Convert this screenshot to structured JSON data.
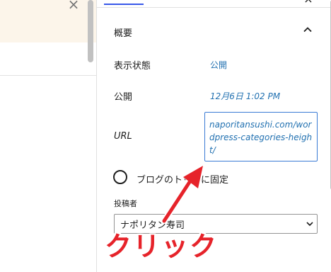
{
  "notice": {
    "close_glyph": "×"
  },
  "sidebar": {
    "close_glyph": "×",
    "panel": {
      "title": "概要",
      "toggle_icon": "chevron-up-icon",
      "visibility": {
        "label": "表示状態",
        "value": "公開"
      },
      "publish": {
        "label": "公開",
        "value": "12月6日 1:02 PM"
      },
      "url": {
        "label": "URL",
        "value": "naporitansushi.com/wordpress-categories-height/"
      },
      "sticky": {
        "label": "ブログのトップに固定"
      },
      "author": {
        "label": "投稿者",
        "value": "ナポリタン寿司"
      }
    }
  },
  "annotation": {
    "caption": "クリック",
    "color": "#e6232a"
  },
  "colors": {
    "link": "#2271b1",
    "focus_border": "#3a7bd5",
    "notice_bg": "#fcf5ea"
  }
}
